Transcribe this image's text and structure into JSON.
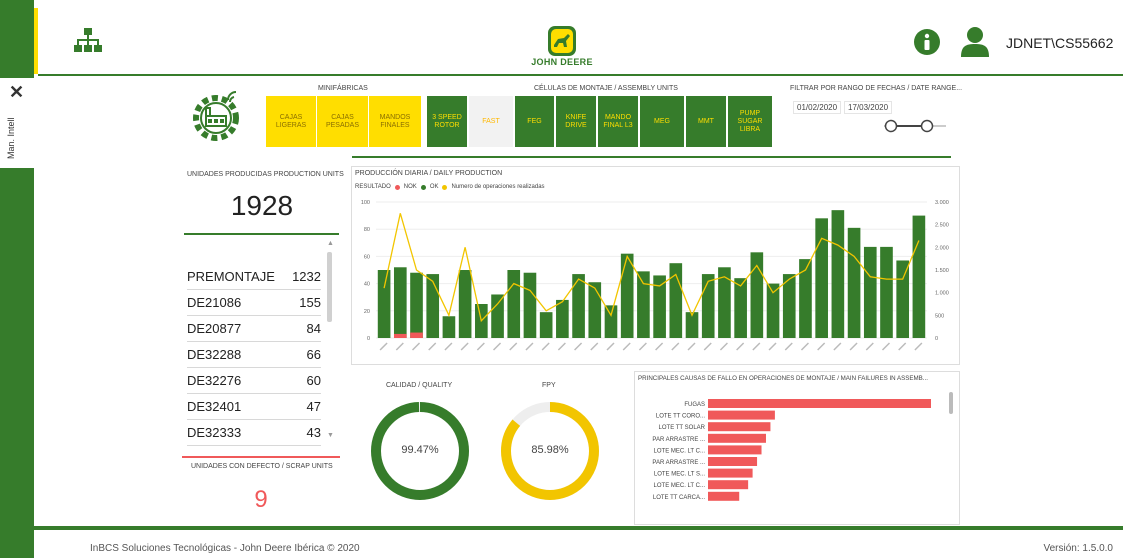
{
  "app": {
    "user": "JDNET\\CS55662",
    "brand": "JOHN DEERE",
    "side_label": "Man. Intell",
    "footer_left": "InBCS Soluciones Tecnológicas - John Deere Ibérica © 2020",
    "footer_right": "Versión: 1.5.0.0",
    "colors": {
      "green": "#367c2b",
      "yellow": "#ffde00",
      "red": "#f0595a",
      "line": "#f2c500"
    }
  },
  "icons": [
    "network-icon",
    "john-deere-logo",
    "info-icon",
    "user-icon",
    "close-icon",
    "factory-icon",
    "range-slider"
  ],
  "filters": {
    "minifabricas_title": "MINIFÁBRICAS",
    "celulas_title": "CÉLULAS DE MONTAJE / ASSEMBLY UNITS",
    "dates_title": "FILTRAR POR RANGO DE FECHAS / DATE RANGE...",
    "date_from": "01/02/2020",
    "date_to": "17/03/2020",
    "minifabricas": [
      {
        "label": "CAJAS LIGERAS"
      },
      {
        "label": "CAJAS PESADAS"
      },
      {
        "label": "MANDOS FINALES"
      }
    ],
    "celulas": [
      {
        "label": "3 SPEED ROTOR"
      },
      {
        "label": "FAST"
      },
      {
        "label": "FEG"
      },
      {
        "label": "KNIFE DRIVE"
      },
      {
        "label": "MANDO FINAL L3"
      },
      {
        "label": "MEG"
      },
      {
        "label": "MMT"
      },
      {
        "label": "PUMP SUGAR LIBRA"
      }
    ]
  },
  "units": {
    "title": "UNIDADES PRODUCIDAS PRODUCTION UNITS",
    "total": "1928",
    "rows": [
      {
        "name": "PREMONTAJE",
        "value": "1232"
      },
      {
        "name": "DE21086",
        "value": "155"
      },
      {
        "name": "DE20877",
        "value": "84"
      },
      {
        "name": "DE32288",
        "value": "66"
      },
      {
        "name": "DE32276",
        "value": "60"
      },
      {
        "name": "DE32401",
        "value": "47"
      },
      {
        "name": "DE32333",
        "value": "43"
      }
    ]
  },
  "scrap": {
    "title": "UNIDADES CON DEFECTO / SCRAP UNITS",
    "value": "9"
  },
  "quality": {
    "title": "CALIDAD / QUALITY",
    "value_text": "99.47%",
    "fraction": 0.9947
  },
  "fpy": {
    "title": "FPY",
    "value_text": "85.98%",
    "fraction": 0.8598
  },
  "chart_data": [
    {
      "type": "bar",
      "title": "PRODUCCIÓN DIARIA / DAILY PRODUCTION",
      "legend_title": "RESULTADO",
      "legend": [
        {
          "name": "NOK",
          "color": "#f0595a"
        },
        {
          "name": "OK",
          "color": "#367c2b"
        },
        {
          "name": "Numero de operaciones realizadas",
          "color": "#f2c500"
        }
      ],
      "legend_placement": "top-left",
      "ylim": [
        0,
        100
      ],
      "yticks": [
        "0",
        "20",
        "40",
        "60",
        "80",
        "100"
      ],
      "y2lim": [
        0,
        3000
      ],
      "y2ticks": [
        "0",
        "500",
        "1.000",
        "1.500",
        "2.000",
        "2.500",
        "3.000"
      ],
      "series": [
        {
          "name": "OK",
          "values": [
            50,
            52,
            48,
            47,
            16,
            50,
            25,
            32,
            50,
            48,
            19,
            28,
            47,
            41,
            24,
            62,
            49,
            46,
            55,
            19,
            47,
            52,
            44,
            63,
            40,
            47,
            58,
            88,
            94,
            81,
            67,
            67,
            57,
            90
          ]
        },
        {
          "name": "NOK",
          "values": [
            0,
            3,
            4,
            0,
            0,
            0,
            0,
            0,
            0,
            0,
            0,
            0,
            0,
            0,
            0,
            0,
            0,
            0,
            0,
            0,
            0,
            0,
            0,
            0,
            0,
            0,
            0,
            0,
            0,
            0,
            0,
            0,
            0,
            0
          ]
        },
        {
          "name": "Numero de operaciones realizadas",
          "axis": "secondary",
          "values": [
            1100,
            2750,
            1500,
            1250,
            500,
            2000,
            380,
            750,
            1200,
            1050,
            600,
            800,
            1300,
            1100,
            500,
            1800,
            1200,
            1150,
            1400,
            500,
            1250,
            1350,
            1150,
            1600,
            1000,
            1300,
            1500,
            2200,
            2050,
            1800,
            1350,
            1300,
            1300,
            2150
          ]
        }
      ],
      "grid": true
    },
    {
      "type": "bar",
      "orientation": "horizontal",
      "title": "PRINCIPALES CAUSAS DE FALLO EN OPERACIONES DE MONTAJE / MAIN FAILURES IN ASSEMB...",
      "categories": [
        "FUGAS",
        "LOTE TT CORO...",
        "LOTE TT SOLAR",
        "PAR ARRASTRE ...",
        "LOTE MEC. LT C...",
        "PAR ARRASTRE ...",
        "LOTE MEC. LT S...",
        "LOTE MEC. LT C...",
        "LOTE TT CARCA..."
      ],
      "values": [
        100,
        30,
        28,
        26,
        24,
        22,
        20,
        18,
        14
      ],
      "color": "#f0595a"
    }
  ]
}
